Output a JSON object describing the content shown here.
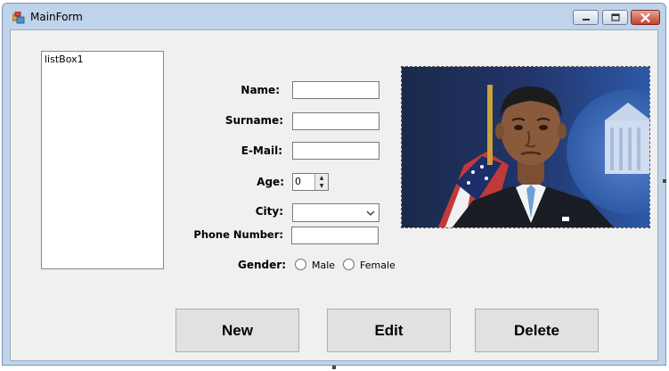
{
  "window": {
    "title": "MainForm"
  },
  "listbox": {
    "items": [
      "listBox1"
    ]
  },
  "form": {
    "name_label": "Name:",
    "surname_label": "Surname:",
    "email_label": "E-Mail:",
    "age_label": "Age:",
    "age_value": "0",
    "city_label": "City:",
    "city_value": "",
    "phone_label": "Phone Number:",
    "gender_label": "Gender:",
    "gender_options": [
      "Male",
      "Female"
    ],
    "name_value": "",
    "surname_value": "",
    "email_value": "",
    "phone_value": ""
  },
  "buttons": {
    "new_label": "New",
    "edit_label": "Edit",
    "delete_label": "Delete"
  },
  "icons": {
    "app": "app-form-icon",
    "minimize": "minimize-icon",
    "maximize": "maximize-icon",
    "close": "close-icon",
    "combo": "chevron-down-icon",
    "spin_up": "arrow-up-icon",
    "spin_down": "arrow-down-icon"
  },
  "colors": {
    "window_frame": "#bfd3ea",
    "client_bg": "#f0f0f0",
    "button_bg": "#e1e1e1",
    "close_button": "#c5402a"
  }
}
